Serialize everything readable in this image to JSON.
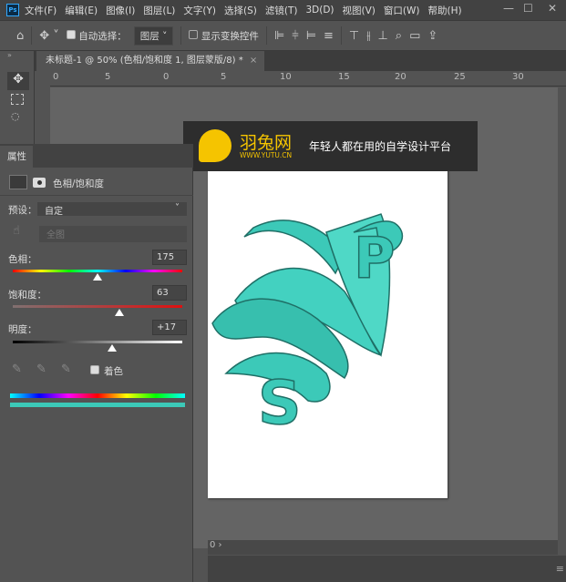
{
  "menubar": {
    "logo": "Ps",
    "items": [
      "文件(F)",
      "编辑(E)",
      "图像(I)",
      "图层(L)",
      "文字(Y)",
      "选择(S)",
      "滤镜(T)",
      "3D(D)",
      "视图(V)",
      "窗口(W)",
      "帮助(H)"
    ]
  },
  "options": {
    "auto_select_label": "自动选择：",
    "auto_select_checked": true,
    "layer_select": "图层",
    "show_transform_label": "显示变换控件",
    "show_transform_checked": false
  },
  "document_tab": {
    "title": "未标题-1 @ 50% (色相/饱和度 1, 图层蒙版/8) *",
    "close": "×"
  },
  "ruler": {
    "ticks": [
      "0",
      "5",
      "0",
      "5",
      "10",
      "15",
      "20",
      "25",
      "30"
    ]
  },
  "watermark": {
    "brand": "羽兔网",
    "url": "WWW.YUTU.CN",
    "slogan": "年轻人都在用的自学设计平台"
  },
  "properties": {
    "tab": "属性",
    "adjustment_title": "色相/饱和度",
    "preset_label": "预设：",
    "preset_value": "自定",
    "channel_value": "全图",
    "hue_label": "色相：",
    "hue": "175",
    "saturation_label": "饱和度：",
    "saturation": "63",
    "lightness_label": "明度：",
    "lightness": "+17",
    "colorize_label": "着色",
    "colorize_checked": true,
    "hue_fraction": 0.5,
    "saturation_fraction": 0.63,
    "lightness_fraction": 0.585
  },
  "canvas": {
    "tint_color": "#3cc9b8"
  },
  "status": {
    "text": "0 ›"
  }
}
